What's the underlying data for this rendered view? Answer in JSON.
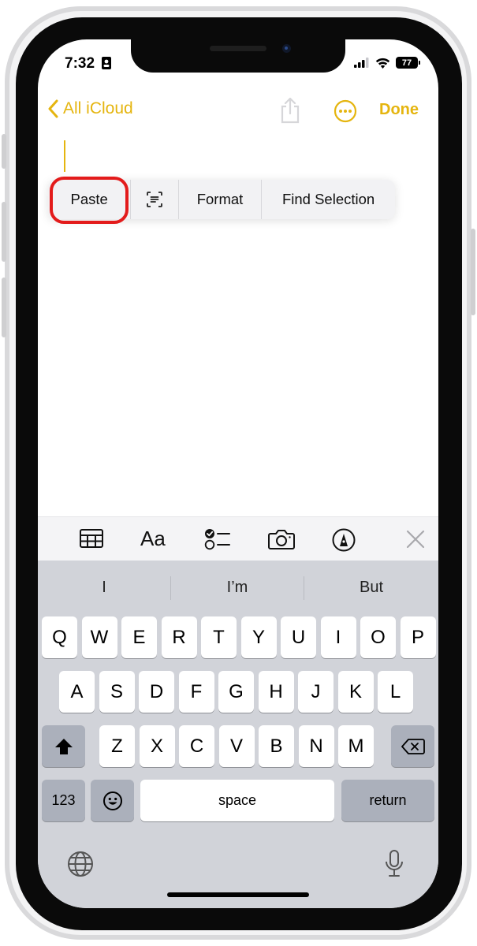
{
  "status_bar": {
    "time": "7:32",
    "battery": "77"
  },
  "nav": {
    "back_label": "All iCloud",
    "done_label": "Done"
  },
  "edit_menu": {
    "paste": "Paste",
    "format": "Format",
    "find_selection": "Find Selection"
  },
  "colors": {
    "accent": "#e5b50f",
    "highlight": "#e31b1b",
    "keyboard_bg": "#d1d3d9"
  },
  "toolbar": {
    "format_label": "Aa",
    "icons": [
      "table-icon",
      "format-icon",
      "checklist-icon",
      "camera-icon",
      "markup-icon",
      "close-icon"
    ]
  },
  "keyboard": {
    "suggestions": [
      "I",
      "I’m",
      "But"
    ],
    "row1": [
      "Q",
      "W",
      "E",
      "R",
      "T",
      "Y",
      "U",
      "I",
      "O",
      "P"
    ],
    "row2": [
      "A",
      "S",
      "D",
      "F",
      "G",
      "H",
      "J",
      "K",
      "L"
    ],
    "row3": [
      "Z",
      "X",
      "C",
      "V",
      "B",
      "N",
      "M"
    ],
    "numbers": "123",
    "space": "space",
    "return": "return"
  }
}
